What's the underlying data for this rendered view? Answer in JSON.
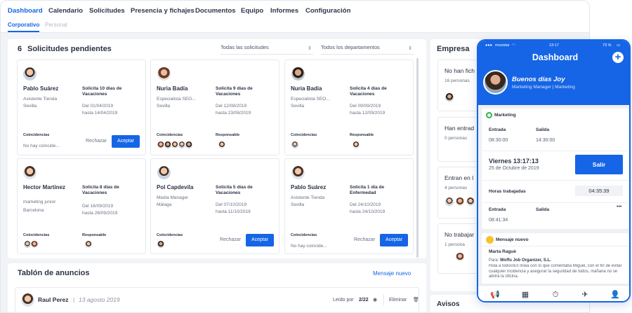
{
  "nav": {
    "items": [
      "Dashboard",
      "Calendario",
      "Solicitudes",
      "Presencia y fichajes",
      "Documentos",
      "Equipo",
      "Informes",
      "Configuración"
    ],
    "active": "Dashboard",
    "subtabs": [
      "Corporativo",
      "Personal"
    ]
  },
  "requests": {
    "count": "6",
    "title": "Solicitudes pendientes",
    "filter_type": "Todas las solicitudes",
    "filter_dept": "Todos los departamentos",
    "coincidencias_label": "Coincidencias",
    "responsable_label": "Responsable",
    "reject_label": "Rechazar",
    "accept_label": "Aceptar",
    "cards": [
      {
        "name": "Pablo Suárez",
        "role": "Asistente Tienda",
        "city": "Sevilla",
        "request": "Solicita 10 días de Vacaciones",
        "from": "Del 01/04/2019",
        "to": "hasta 14/04/2019",
        "coincidence": "No hay coincide..."
      },
      {
        "name": "Nuria Badía",
        "role": "Especialista SEO...",
        "city": "Sevilla",
        "request": "Solicita 9 días de Vacaciones",
        "from": "Del 12/08/2019",
        "to": "hasta 23/08/2019"
      },
      {
        "name": "Nuria Badía",
        "role": "Especialista SEO...",
        "city": "Sevilla",
        "request": "Solicita 4 días de Vacaciones",
        "from": "Del 09/09/2019",
        "to": "hasta 12/09/2019"
      },
      {
        "name": "Hector Martinez",
        "role": "marketing junior",
        "city": "Barcelona",
        "request": "Solicita 8 días de Vacaciones",
        "from": "Del 16/09/2019",
        "to": "hasta 26/09/2019"
      },
      {
        "name": "Pol Capdevila",
        "role": "Media Manager",
        "city": "Málaga",
        "request": "Solicita 5 días de Vacaciones",
        "from": "Del 07/10/2019",
        "to": "hasta 11/10/2019"
      },
      {
        "name": "Pablo Suárez",
        "role": "Asistente Tienda",
        "city": "Sevilla",
        "request": "Solicita 1 día de Enfermedad",
        "from": "Del 24/10/2019",
        "to": "hasta 24/10/2019",
        "coincidence": "No hay coincide..."
      }
    ]
  },
  "board": {
    "title": "Tablón de anuncios",
    "new_message": "Mensaje nuevo",
    "post_author": "Raul Perez",
    "post_date": "13 agosto 2019",
    "read_label": "Leído por",
    "read_count": "2/22",
    "delete_label": "Eliminar"
  },
  "empresa": {
    "title": "Empresa",
    "cards": [
      {
        "title": "No han fich",
        "sub": "16 personas"
      },
      {
        "title": "Han entrad",
        "sub": "0 personas"
      },
      {
        "title": "Entran en l",
        "sub": "4 personas"
      },
      {
        "title": "No trabajar",
        "sub": "1 persona"
      }
    ],
    "avisos": "Avisos"
  },
  "phone": {
    "carrier": "movistar",
    "time": "13:17",
    "battery": "73 %",
    "title": "Dashboard",
    "greeting": "Buenos días Joy",
    "role": "Marketing Manager | Marketing",
    "dept": "Marketing",
    "entrada_label": "Entrada",
    "salida_label": "Salida",
    "entrada_time": "08:30:00",
    "salida_time": "14:30:00",
    "day": "Viernes 13:17:13",
    "date": "25 de Octubre de 2019",
    "salir_label": "Salir",
    "hours_label": "Horas trabajadas",
    "hours_value": "04:35:39",
    "entrada2_time": "08:41:34",
    "more": "•••",
    "message_label": "Mensaje nuevo",
    "message_author": "Marta Raguè",
    "message_to_label": "Para:",
    "message_to": "Woffu Job Organizer, S.L.",
    "message_body": "Hola a todos!En línea con lo que comentaba Miguel, con el fin de evitar cualquier incidencia y asegurar la seguridad de todos, mañana no se abrirá la oficina."
  },
  "colors": {
    "accent": "#1565e6"
  }
}
